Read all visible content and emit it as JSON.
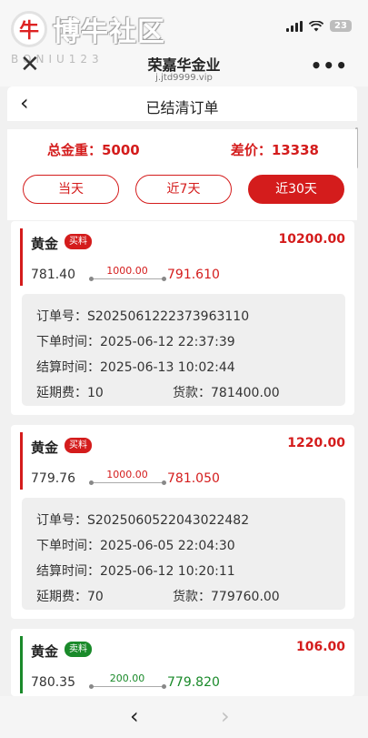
{
  "watermark": {
    "logo_text": "博牛社区",
    "sub_text": "BONIU123"
  },
  "status_bar": {
    "battery": "23"
  },
  "browser": {
    "title": "荣嘉华金业",
    "url": "j.jtd9999.vip",
    "close_icon": "close-icon",
    "more_icon": "more-icon"
  },
  "header": {
    "title": "已结清订单"
  },
  "summary": {
    "total_weight": "总金重：5000",
    "price_diff": "差价：13338"
  },
  "filters": [
    {
      "label": "当天",
      "active": false
    },
    {
      "label": "近7天",
      "active": false
    },
    {
      "label": "近30天",
      "active": true
    }
  ],
  "orders": [
    {
      "metal": "黄金",
      "tag": "买料",
      "amount": "10200.00",
      "buy_price": "781.40",
      "diff": "1000.00",
      "sell_price": "791.610",
      "order_no": "订单号：S2025061222373963110",
      "order_time": "下单时间：2025-06-12 22:37:39",
      "settle_time": "结算时间：2025-06-13 10:02:44",
      "delay_fee": "延期费：10",
      "payment": "货款：781400.00",
      "color": "#d41c1c"
    },
    {
      "metal": "黄金",
      "tag": "买料",
      "amount": "1220.00",
      "buy_price": "779.76",
      "diff": "1000.00",
      "sell_price": "781.050",
      "order_no": "订单号：S2025060522043022482",
      "order_time": "下单时间：2025-06-05 22:04:30",
      "settle_time": "结算时间：2025-06-12 10:20:11",
      "delay_fee": "延期费：70",
      "payment": "货款：779760.00",
      "color": "#d41c1c"
    },
    {
      "metal": "黄金",
      "tag": "卖料",
      "amount": "106.00",
      "buy_price": "780.35",
      "diff": "200.00",
      "sell_price": "779.820",
      "color": "#1a8a2a"
    }
  ],
  "nav": {
    "back_icon": "chevron-left-icon",
    "forward_icon": "chevron-right-icon"
  }
}
